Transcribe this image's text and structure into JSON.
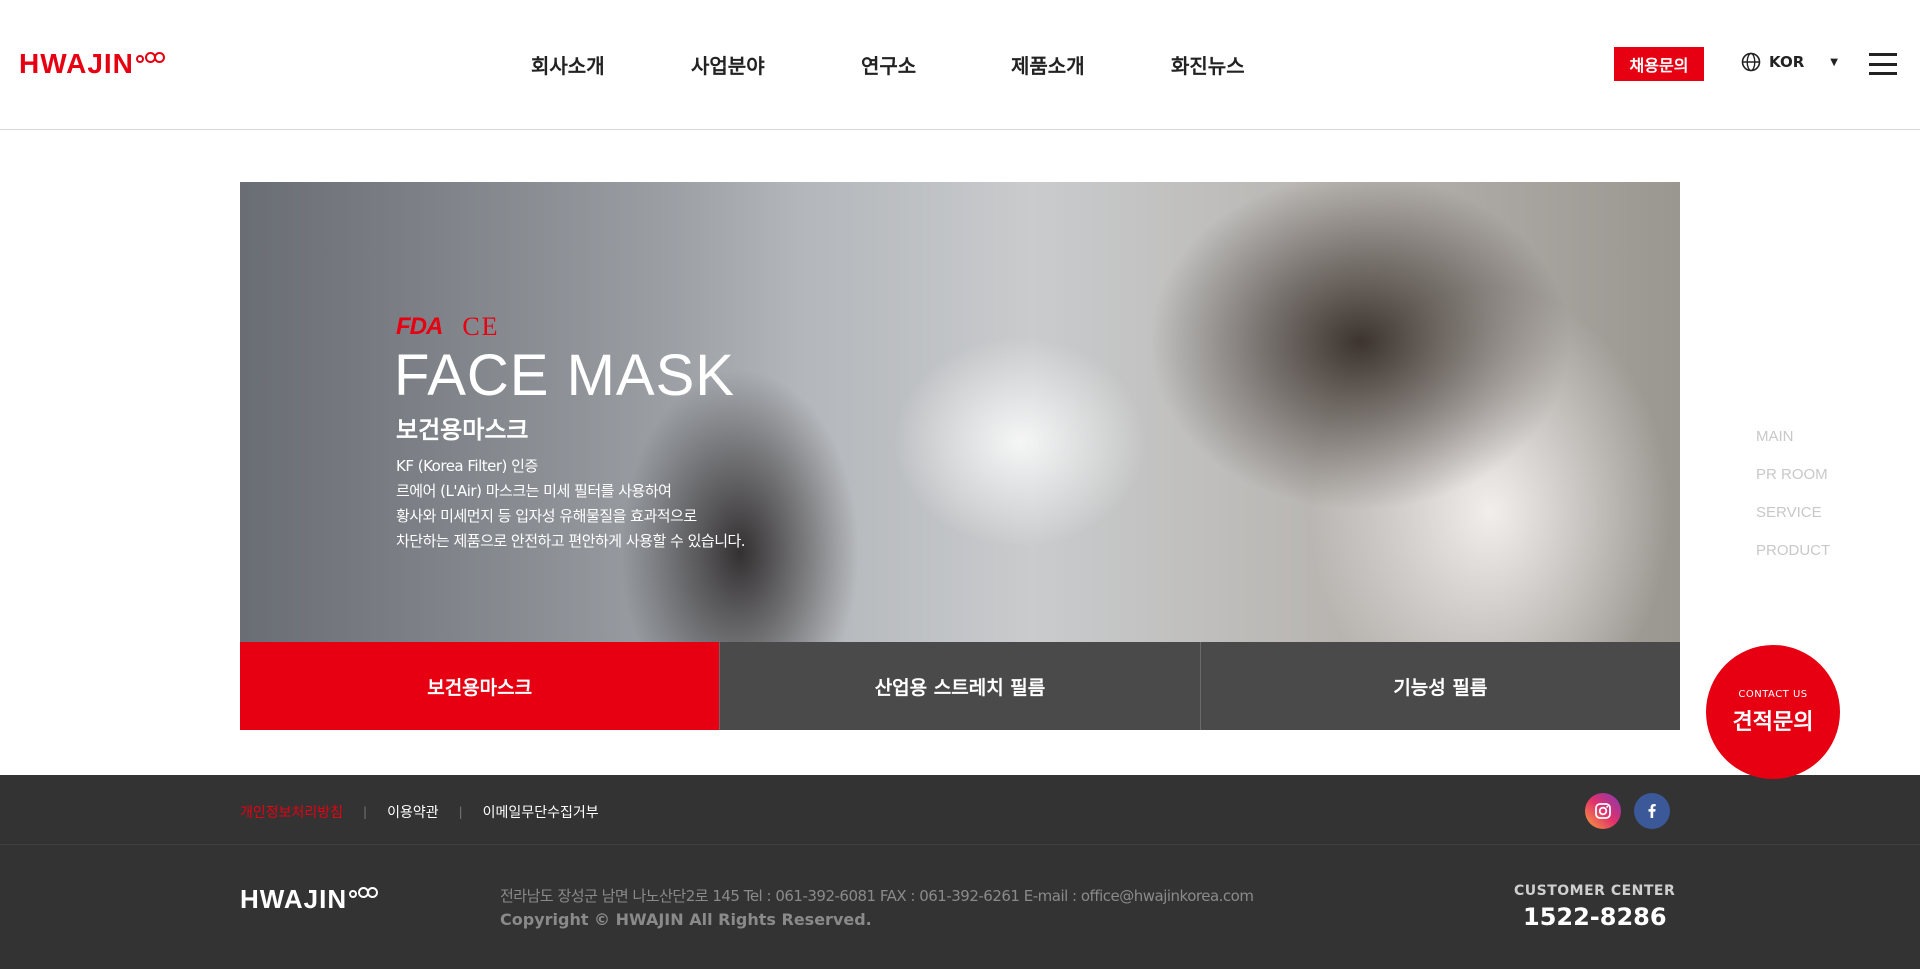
{
  "header": {
    "logo_text": "HWAJIN",
    "nav": [
      "회사소개",
      "사업분야",
      "연구소",
      "제품소개",
      "화진뉴스"
    ],
    "recruit_label": "채용문의",
    "lang_label": "KOR"
  },
  "hero": {
    "cert_fda": "FDA",
    "cert_ce": "CE",
    "title": "FACE MASK",
    "subtitle": "보건용마스크",
    "desc": [
      "KF (Korea Filter) 인증",
      "르에어 (L'Air) 마스크는 미세 필터를 사용하여",
      "황사와 미세먼지 등 입자성 유해물질을 효과적으로",
      "차단하는 제품으로 안전하고 편안하게 사용할 수 있습니다."
    ],
    "tabs": [
      "보건용마스크",
      "산업용 스트레치 필름",
      "기능성 필름"
    ]
  },
  "sidenav": [
    "MAIN",
    "PR ROOM",
    "SERVICE",
    "PRODUCT"
  ],
  "contact": {
    "small": "CONTACT US",
    "big": "견적문의"
  },
  "footer": {
    "links": [
      "개인정보처리방침",
      "이용약관",
      "이메일무단수집거부"
    ],
    "logo_text": "HWAJIN",
    "address": "전라남도 장성군 남면 나노산단2로 145 Tel : 061-392-6081 FAX : 061-392-6261 E-mail : office@hwajinkorea.com",
    "copyright": "Copyright © HWAJIN All Rights Reserved.",
    "cc_label": "CUSTOMER CENTER",
    "cc_phone": "1522-8286"
  },
  "colors": {
    "brand": "#e60012",
    "footer_bg": "#333333",
    "tab_bg": "#4a4a4a"
  },
  "icons": [
    "globe-icon",
    "caret-down-icon",
    "menu-icon",
    "instagram-icon",
    "facebook-icon"
  ]
}
